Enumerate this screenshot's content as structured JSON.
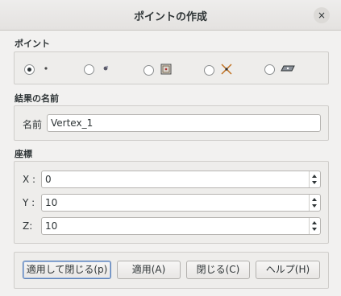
{
  "window": {
    "title": "ポイントの作成",
    "close_glyph": "×"
  },
  "point_section": {
    "title": "ポイント",
    "options": [
      {
        "icon": "point-coords-icon",
        "selected": true
      },
      {
        "icon": "point-ref-icon",
        "selected": false
      },
      {
        "icon": "point-on-edge-icon",
        "selected": false
      },
      {
        "icon": "point-intersection-icon",
        "selected": false
      },
      {
        "icon": "point-on-face-icon",
        "selected": false
      }
    ]
  },
  "result_section": {
    "title": "結果の名前",
    "name_label": "名前",
    "name_value": "Vertex_1"
  },
  "coord_section": {
    "title": "座標",
    "x_label": "X :",
    "x_value": "0",
    "y_label": "Y :",
    "y_value": "10",
    "z_label": "Z:",
    "z_value": "10"
  },
  "buttons": {
    "apply_close": "適用して閉じる(p)",
    "apply": "適用(A)",
    "close": "閉じる(C)",
    "help": "ヘルプ(H)"
  }
}
